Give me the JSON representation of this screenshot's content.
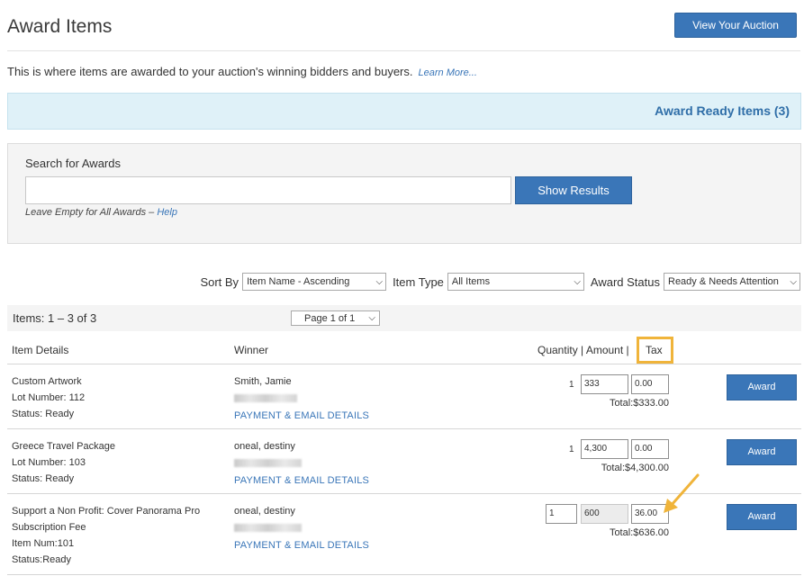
{
  "page": {
    "title": "Award Items",
    "view_auction_label": "View Your Auction",
    "intro_text": "This is where items are awarded to your auction's winning bidders and buyers.",
    "learn_more": "Learn More..."
  },
  "banner": {
    "ready_label": "Award Ready Items (3)"
  },
  "search": {
    "label": "Search for Awards",
    "value": "",
    "button": "Show Results",
    "hint_prefix": "Leave Empty for All Awards – ",
    "help": "Help"
  },
  "filters": {
    "sort_label": "Sort By",
    "sort_value": "Item Name - Ascending",
    "type_label": "Item Type",
    "type_value": "All Items",
    "status_label": "Award Status",
    "status_value": "Ready & Needs Attention"
  },
  "list": {
    "count": "Items: 1 – 3 of 3",
    "page": "Page 1 of 1"
  },
  "columns": {
    "item": "Item Details",
    "winner": "Winner",
    "qty_amount": "Quantity | Amount |",
    "tax": "Tax"
  },
  "rows": [
    {
      "name": "Custom Artwork",
      "lot": "Lot Number: 112",
      "status": "Status: Ready",
      "winner": "Smith, Jamie",
      "pay_link": "PAYMENT & EMAIL DETAILS",
      "qty": "1",
      "amount": "333",
      "tax": "0.00",
      "total": "Total:$333.00",
      "award": "Award"
    },
    {
      "name": "Greece Travel Package",
      "lot": "Lot Number: 103",
      "status": "Status: Ready",
      "winner": "oneal, destiny",
      "pay_link": "PAYMENT & EMAIL DETAILS",
      "qty": "1",
      "amount": "4,300",
      "tax": "0.00",
      "total": "Total:$4,300.00",
      "award": "Award"
    },
    {
      "name_line1": "Support a Non Profit: Cover Panorama Pro",
      "name_line2": "Subscription Fee",
      "lot": "Item Num:101",
      "status": "Status:Ready",
      "winner": "oneal, destiny",
      "pay_link": "PAYMENT & EMAIL DETAILS",
      "qty": "1",
      "amount": "600",
      "tax": "36.00",
      "total": "Total:$636.00",
      "award": "Award"
    }
  ],
  "colors": {
    "primary_button": "#3a76b8",
    "banner_bg": "#dff1f8",
    "highlight": "#f0b43a",
    "link": "#3a76b8"
  },
  "icons": [
    "chevron-down-icon",
    "arrow-pointer-icon"
  ]
}
